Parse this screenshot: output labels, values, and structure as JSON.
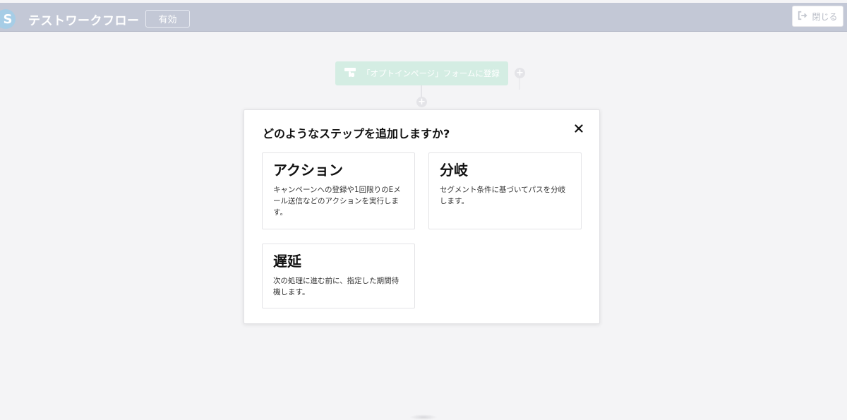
{
  "header": {
    "logo_letter": "S",
    "workflow_title": "テストワークフロー",
    "status_label": "有効",
    "close_label": "閉じる",
    "close_icon": "sign-out-icon"
  },
  "canvas": {
    "trigger": {
      "icon": "form-hand-icon",
      "label": "「オプトインページ」フォームに登録"
    },
    "add_symbol": "+"
  },
  "modal": {
    "title": "どのようなステップを追加しますか?",
    "close_icon": "close-icon",
    "options": {
      "action": {
        "title": "アクション",
        "description": "キャンペーンへの登録や1回限りのEメール送信などのアクションを実行します。"
      },
      "branch": {
        "title": "分岐",
        "description": "セグメント条件に基づいてパスを分岐します。"
      },
      "delay": {
        "title": "遅延",
        "description": "次の処理に進む前に、指定した期間待機します。"
      }
    }
  },
  "colors": {
    "header_bg": "#c3c8d6",
    "trigger_bg": "#d4ede3",
    "logo_bg": "#a6cde6",
    "page_bg": "#f4f4f6"
  }
}
